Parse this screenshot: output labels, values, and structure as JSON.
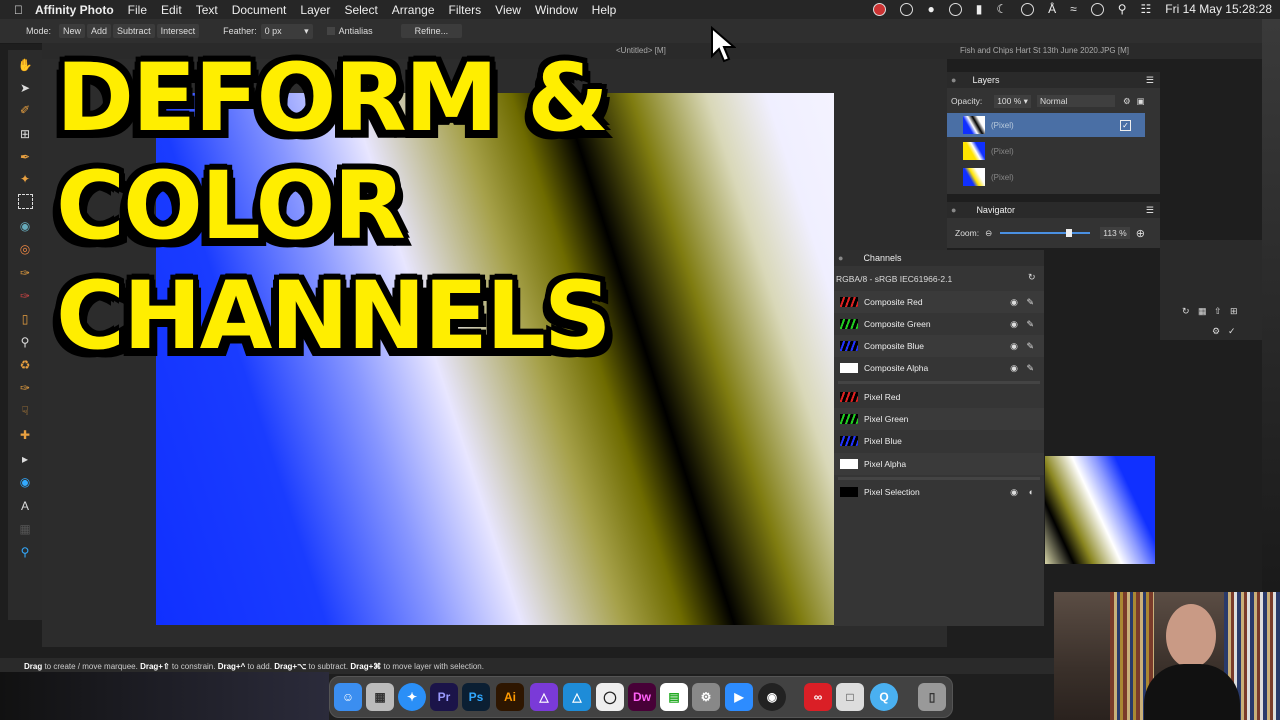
{
  "menubar": {
    "app": "Affinity Photo",
    "items": [
      "File",
      "Edit",
      "Text",
      "Document",
      "Layer",
      "Select",
      "Arrange",
      "Filters",
      "View",
      "Window",
      "Help"
    ],
    "clock": "Fri 14 May  15:28:28"
  },
  "context_toolbar": {
    "mode_label": "Mode:",
    "new": "New",
    "add": "Add",
    "subtract": "Subtract",
    "intersect": "Intersect",
    "feather_label": "Feather:",
    "feather_value": "0 px",
    "antialias": "Antialias",
    "refine": "Refine..."
  },
  "tabs": [
    "<Untitled> [M]",
    "Fish and Chips Hart St 13th June 2020.JPG [M]"
  ],
  "overlay_title": [
    "DEFORM &",
    "COLOR",
    "CHANNELS"
  ],
  "layers": {
    "title": "Layers",
    "opacity_label": "Opacity:",
    "opacity_value": "100 %",
    "blend_mode": "Normal",
    "rows": [
      "(Pixel)",
      "(Pixel)",
      "(Pixel)"
    ]
  },
  "navigator": {
    "title": "Navigator",
    "zoom_label": "Zoom:",
    "zoom_value": "113 %"
  },
  "channels": {
    "title": "Channels",
    "profile": "RGBA/8 - sRGB IEC61966-2.1",
    "composite": [
      "Composite Red",
      "Composite Green",
      "Composite Blue",
      "Composite Alpha"
    ],
    "pixel": [
      "Pixel Red",
      "Pixel Green",
      "Pixel Blue",
      "Pixel Alpha"
    ],
    "selection": "Pixel Selection"
  },
  "status": {
    "drag1": "Drag",
    "t1": " to create / move marquee. ",
    "drag2": "Drag+⇧",
    "t2": " to constrain. ",
    "drag3": "Drag+^",
    "t3": " to add. ",
    "drag4": "Drag+⌥",
    "t4": " to subtract. ",
    "drag5": "Drag+⌘",
    "t5": " to move layer with selection."
  },
  "dock_labels": [
    "Pr",
    "Ps",
    "Ai",
    "Dw"
  ],
  "colors": {
    "title_yellow": "#ffee00",
    "selection_blue": "#4a6fa5"
  }
}
